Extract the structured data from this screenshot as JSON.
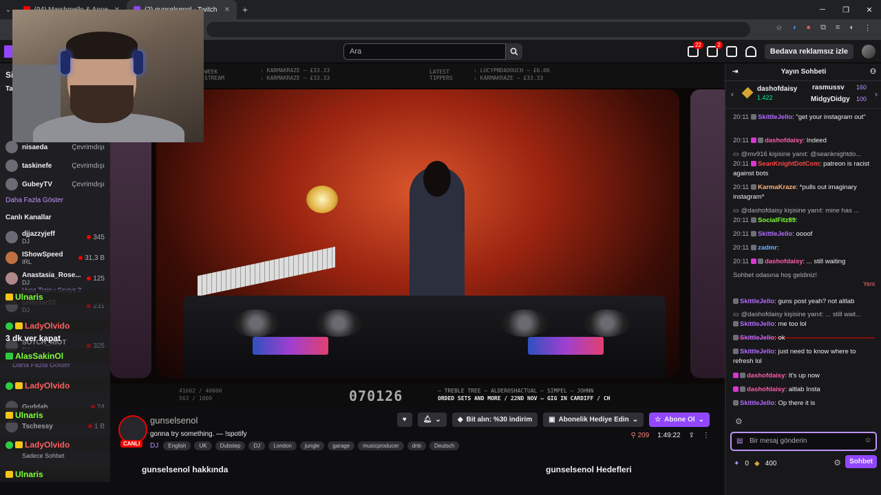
{
  "browser": {
    "tabs": [
      {
        "label": "(94) Marshmello & Anne-Marie",
        "favicon_color": "#ff0000"
      },
      {
        "label": "(2) gunselsenol - Twitch",
        "favicon_color": "#9147ff"
      }
    ],
    "new_tab": "+"
  },
  "twitch_nav": {
    "search_placeholder": "Ara",
    "notif_badge_1": "22",
    "notif_badge_2": "2",
    "adfree_label": "Bedava reklamsız izle"
  },
  "sidebar": {
    "section_initial": "Si",
    "section_initial2": "Ta",
    "followed": [
      {
        "name": "nisaeda",
        "status": "Çevrimdışı"
      },
      {
        "name": "taskinefe",
        "status": "Çevrimdışı"
      },
      {
        "name": "GubeyTV",
        "status": "Çevrimdışı"
      }
    ],
    "show_more": "Daha Fazla Göster",
    "live_header": "Canlı Kanallar",
    "live": [
      {
        "name": "djjazzyjeff",
        "category": "DJ",
        "viewers": "345"
      },
      {
        "name": "IShowSpeed",
        "category": "IRL",
        "viewers": "31,3 B"
      },
      {
        "name": "Anastasia_Rose...",
        "category": "DJ",
        "viewers": "125",
        "extra": "Hype Train • Seviye 2"
      },
      {
        "name": "selectar20",
        "category": "DJ",
        "viewers": "231"
      },
      {
        "name": "SOTCH_RIOT",
        "category": "DJ",
        "viewers": "325"
      },
      {
        "name": "Guddah",
        "category": "",
        "viewers": "74"
      },
      {
        "name": "Tschessy",
        "category": "",
        "viewers": "1 B"
      }
    ],
    "show_more2": "Daha Fazla Göster",
    "chat_only": "Sadece Sohbet"
  },
  "overlay_alerts": [
    {
      "name": "Ulnaris",
      "kind": "crown"
    },
    {
      "name": "LadyOlvido",
      "kind": "check"
    },
    {
      "name": "3 dk ver kapat",
      "kind": "text"
    },
    {
      "name": "AlasSakinOl",
      "kind": "plain"
    },
    {
      "name": "LadyOlvido",
      "kind": "check"
    },
    {
      "name": "Ulnaris",
      "kind": "crown"
    },
    {
      "name": "LadyOlvido",
      "kind": "check"
    },
    {
      "name": "Ulnaris",
      "kind": "crown"
    }
  ],
  "video": {
    "top_left": "WEEK\nSTREAM",
    "top_text1": ": KARMAKRAZE — £33.33",
    "top_text2": ": KARMAKRAZE — £33.33",
    "latest_label": "LATEST\nTIPPERS",
    "tipper1": ": LUCYPNDAOOUCH — £6.06",
    "tipper2": ": KARMAKRAZE — £33.33",
    "counter": "070126",
    "stats": "41602 / 40000",
    "stats2": "563 / 1000",
    "ticker": "— TREBLE TREE — ALDEROSHACTUAL — SIMPEL — JOHNN",
    "ticker2": "ORDED SETS AND MORE / 22ND NOV – GIG IN CARDIFF / CH"
  },
  "stream": {
    "channel": "gunselsenol",
    "title": "gonna try something. — !spotify",
    "live_badge": "CANLI",
    "category": "DJ",
    "tags": [
      "English",
      "UK",
      "Dubstep",
      "DJ",
      "London",
      "jungle",
      "garage",
      "musicproducer",
      "dnb",
      "Deutsch"
    ],
    "bits_label": "Bit alın: %30 indirim",
    "gift_label": "Abonelik Hediye Edin",
    "subscribe_label": "Abone Ol",
    "viewers": "209",
    "uptime": "1:49:22",
    "about": "gunselsenol hakkında",
    "goals": "gunselsenol Hedefleri"
  },
  "chat": {
    "title": "Yayın Sohbeti",
    "leaderboard": [
      {
        "name": "dashofdaisy",
        "value": "1.422"
      },
      {
        "name": "rasmussv",
        "value": "160"
      },
      {
        "name": "MidgyDidgy",
        "value": "100"
      }
    ],
    "messages": [
      {
        "time": "20:11",
        "user": "SkittleJello",
        "text": ": \"get your instagram out\"",
        "cls": "u1"
      },
      {
        "time": "20:11",
        "user": "dashofdaisy",
        "text": ": Indeed",
        "cls": "u2"
      },
      {
        "reply": "@mv916 kişisine yanıt: @seanknightdo..."
      },
      {
        "time": "20:11",
        "user": "SeanKnightDotCom",
        "text": ": patreon is racist against bots",
        "cls": "u3"
      },
      {
        "time": "20:11",
        "user": "KarmaKraze",
        "text": ": *pulls out imaginary instagram*",
        "cls": "u4"
      },
      {
        "reply": "@dashofdaisy kişisine yanıt: mine has ..."
      },
      {
        "time": "20:11",
        "user": "SocialFitz89",
        "text": ":",
        "cls": "u5"
      },
      {
        "time": "20:11",
        "user": "SkittleJello",
        "text": ": oooof",
        "cls": "u1"
      },
      {
        "time": "20:11",
        "user": "zadmr",
        "text": ":",
        "cls": "u6"
      },
      {
        "time": "20:11",
        "user": "dashofdaisy",
        "text": ": ... still waiting",
        "cls": "u2"
      },
      {
        "system": "Sohbet odasına hoş geldiniz!"
      },
      {
        "user": "SkittleJello",
        "text": ": guns post yeah? not altlab",
        "cls": "u1"
      },
      {
        "reply": "@dashofdaisy kişisine yanıt: ... still wait..."
      },
      {
        "user": "SkittleJello",
        "text": ": me too lol",
        "cls": "u1"
      },
      {
        "user": "SkittleJello",
        "text": ": ok",
        "cls": "u1"
      },
      {
        "user": "SkittleJello",
        "text": ": just need to know where to refresh lol",
        "cls": "u1"
      },
      {
        "user": "dashofdaisy",
        "text": ": It's up now",
        "cls": "u2"
      },
      {
        "user": "dashofdaisy",
        "text": ": altlab Insta",
        "cls": "u2"
      },
      {
        "user": "SkittleJello",
        "text": ": Op there it is",
        "cls": "u1"
      }
    ],
    "new_label": "Yeni",
    "input_placeholder": "Bir mesaj gönderin",
    "points": "0",
    "bits": "400",
    "send_label": "Sohbet"
  },
  "colors": {
    "accent": "#9147ff",
    "live": "#eb0400",
    "bg": "#0e0e10",
    "panel": "#18181b"
  }
}
